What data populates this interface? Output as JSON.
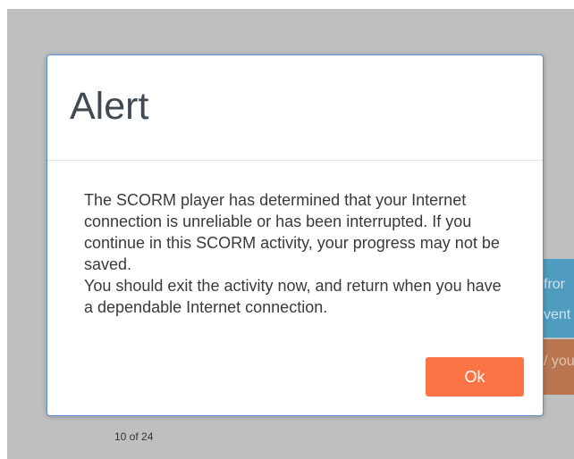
{
  "background": {
    "teal_panel_lines": [
      "fror",
      "vent"
    ],
    "orange_panel_text": "/ you",
    "page_counter": "10 of 24"
  },
  "dialog": {
    "title": "Alert",
    "message_lines": [
      "The SCORM player has determined that your Internet connection is unreliable or has been interrupted. If you continue in this SCORM activity, your progress may not be saved.",
      "You should exit the activity now, and return when you have a dependable Internet connection."
    ],
    "ok_label": "Ok"
  },
  "colors": {
    "overlay": "#bebfc0",
    "dialog_border": "#5b8fd8",
    "ok_button": "#fc7445",
    "background_teal": "#4f9cc0",
    "background_orange": "#b97550"
  }
}
